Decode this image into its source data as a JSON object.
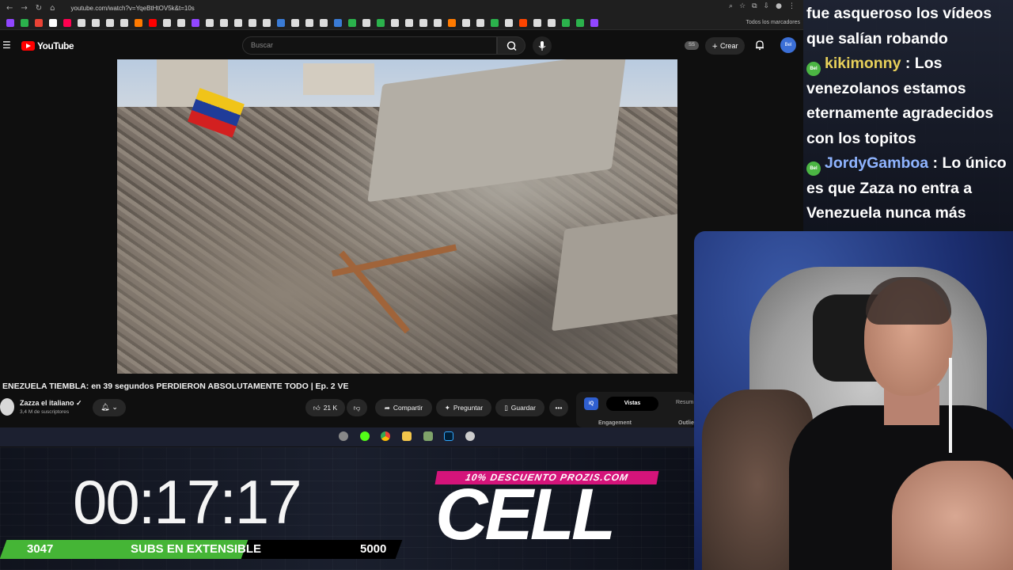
{
  "browser": {
    "url": "youtube.com/watch?v=YqeBtHtOV5k&t=10s",
    "bookmarks_all": "Todos los marcadores"
  },
  "youtube": {
    "logo": "YouTube",
    "search_placeholder": "Buscar",
    "ss_badge": "SS",
    "create_label": "Crear",
    "avatar_label": "Bel",
    "video_title": "ENEZUELA TIEMBLA: en 39 segundos PERDIERON ABSOLUTAMENTE TODO | Ep. 2 VE",
    "channel_name": "Zazza el italiano ✓",
    "channel_subs": "3,4 M de suscriptores",
    "like_count": "21 K",
    "share_label": "Compartir",
    "ask_label": "Preguntar",
    "save_label": "Guardar",
    "more_label": "•••",
    "side_panel": {
      "iq": "iQ",
      "tab_vistas": "Vistas",
      "tab_resumen": "Resum",
      "engagement": "Engagement",
      "outlier": "Outlie"
    }
  },
  "stream": {
    "timer": "00:17:17",
    "subs_current": "3047",
    "subs_label": "SUBS EN EXTENSIBLE",
    "subs_goal": "5000",
    "subs_progress": 0.6094,
    "promo": "10% DESCUENTO PROZIS.COM",
    "sponsor": "CELL"
  },
  "chat": {
    "messages": [
      {
        "user": "",
        "text": "fue asqueroso los vídeos que salían robando"
      },
      {
        "user": "kikimonny",
        "text": "Los venezolanos estamos eternamente agradecidos con los topitos"
      },
      {
        "user": "JordyGamboa",
        "text": "Lo único es que Zaza no entra a Venezuela nunca más"
      }
    ]
  },
  "colors": {
    "accent_red": "#ff0000",
    "subs_green": "#45b536",
    "promo_pink": "#d4147a",
    "user_gold": "#e8d05a",
    "user_blue": "#8fb4ff"
  }
}
